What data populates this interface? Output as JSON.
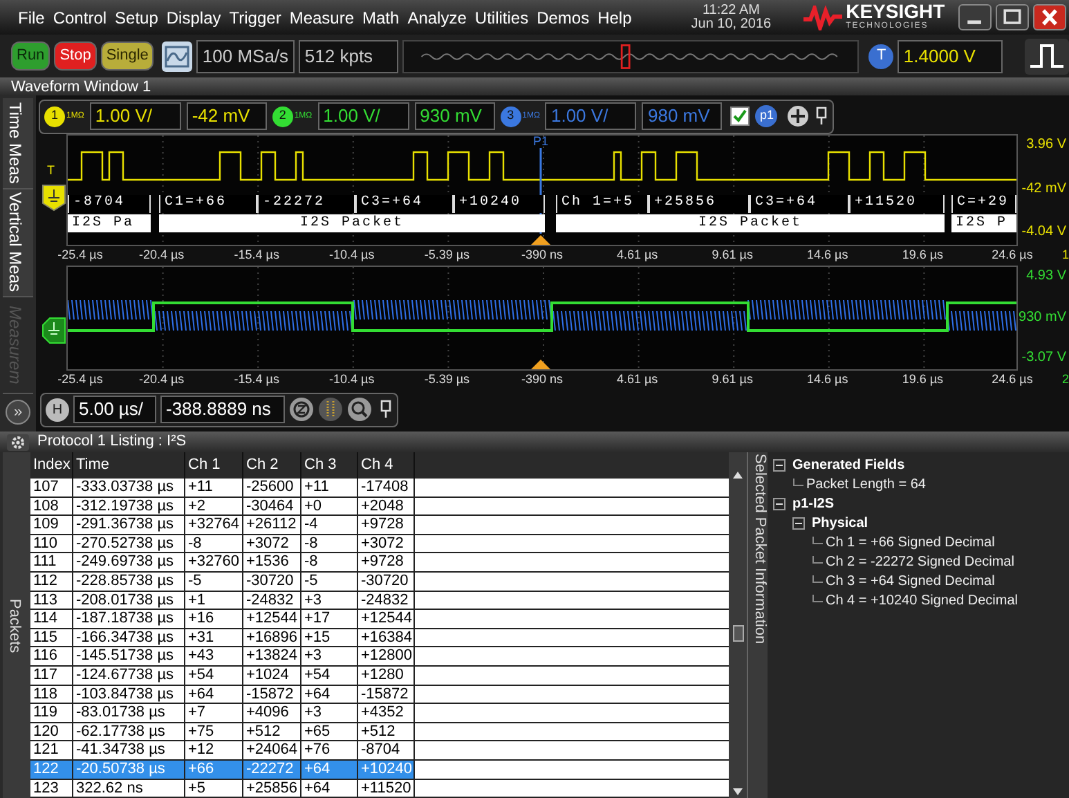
{
  "menu": [
    "File",
    "Control",
    "Setup",
    "Display",
    "Trigger",
    "Measure",
    "Math",
    "Analyze",
    "Utilities",
    "Demos",
    "Help"
  ],
  "clock": {
    "time": "11:22 AM",
    "date": "Jun 10, 2016"
  },
  "logo": {
    "name": "KEYSIGHT",
    "subtitle": "TECHNOLOGIES"
  },
  "acquisition_buttons": [
    {
      "label": "Run",
      "kind": "run"
    },
    {
      "label": "Stop",
      "kind": "stop"
    },
    {
      "label": "Single",
      "kind": "single"
    }
  ],
  "sample_rate": "100 MSa/s",
  "memory_depth": "512 kpts",
  "trigger": {
    "badge": "T",
    "level": "1.4000 V"
  },
  "waveform_window": {
    "title": "Waveform Window 1",
    "side_tabs": [
      {
        "label": "Time Meas",
        "disabled": false
      },
      {
        "label": "Vertical Meas",
        "disabled": false
      },
      {
        "label": "Measurem",
        "disabled": true
      }
    ],
    "channels": [
      {
        "badge": "1",
        "impedance": "1MΩ",
        "scale": "1.00 V/",
        "offset": "-42 mV",
        "color": "#e8e000"
      },
      {
        "badge": "2",
        "impedance": "1MΩ",
        "scale": "1.00 V/",
        "offset": "930 mV",
        "color": "#33dd33"
      },
      {
        "badge": "3",
        "impedance": "1MΩ",
        "scale": "1.00 V/",
        "offset": "980 mV",
        "color": "#3b78e0"
      }
    ],
    "expand_button": "»",
    "p1_checked": true,
    "p1_badge": "p1",
    "plots": [
      {
        "kind": "digital",
        "marker": "P1",
        "trigger_mark": "T",
        "scale_labels": [
          "3.96 V",
          "-42 mV",
          "-4.04 V"
        ],
        "edge_label": "1",
        "decode_values": [
          "-8704",
          "C1=+66",
          "-22272",
          "C3=+64",
          "+10240",
          "Ch 1=+5",
          "+25856",
          "C3=+64",
          "+11520",
          "C=+29"
        ],
        "decode_packets": [
          "I2S Pa",
          "I2S Packet",
          "I2S Packet",
          "I2S P"
        ],
        "x_ticks": [
          "-25.4 µs",
          "-20.4 µs",
          "-15.4 µs",
          "-10.4 µs",
          "-5.39 µs",
          "-390 ns",
          "4.61 µs",
          "9.61 µs",
          "14.6 µs",
          "19.6 µs",
          "24.6 µs"
        ]
      },
      {
        "kind": "analog",
        "scale_labels": [
          "4.93 V",
          "930 mV",
          "-3.07 V"
        ],
        "edge_label": "2",
        "x_ticks": [
          "-25.4 µs",
          "-20.4 µs",
          "-15.4 µs",
          "-10.4 µs",
          "-5.39 µs",
          "-390 ns",
          "4.61 µs",
          "9.61 µs",
          "14.6 µs",
          "19.6 µs",
          "24.6 µs"
        ]
      }
    ],
    "horizontal": {
      "badge": "H",
      "scale": "5.00 µs/",
      "delay": "-388.8889 ns"
    }
  },
  "protocol_listing": {
    "title": "Protocol 1 Listing : I²S",
    "side_tab": "Packets",
    "columns": [
      "Index",
      "Time",
      "Ch 1",
      "Ch 2",
      "Ch 3",
      "Ch 4"
    ],
    "rows": [
      {
        "cells": [
          "107",
          "-333.03738 µs",
          "+11",
          "-25600",
          "+11",
          "-17408"
        ],
        "selected": false
      },
      {
        "cells": [
          "108",
          "-312.19738 µs",
          "+2",
          "-30464",
          "+0",
          "+2048"
        ],
        "selected": false
      },
      {
        "cells": [
          "109",
          "-291.36738 µs",
          "+32764",
          "+26112",
          "-4",
          "+9728"
        ],
        "selected": false
      },
      {
        "cells": [
          "110",
          "-270.52738 µs",
          "-8",
          "+3072",
          "-8",
          "+3072"
        ],
        "selected": false
      },
      {
        "cells": [
          "111",
          "-249.69738 µs",
          "+32760",
          "+1536",
          "-8",
          "+9728"
        ],
        "selected": false
      },
      {
        "cells": [
          "112",
          "-228.85738 µs",
          "-5",
          "-30720",
          "-5",
          "-30720"
        ],
        "selected": false
      },
      {
        "cells": [
          "113",
          "-208.01738 µs",
          "+1",
          "-24832",
          "+3",
          "-24832"
        ],
        "selected": false
      },
      {
        "cells": [
          "114",
          "-187.18738 µs",
          "+16",
          "+12544",
          "+17",
          "+12544"
        ],
        "selected": false
      },
      {
        "cells": [
          "115",
          "-166.34738 µs",
          "+31",
          "+16896",
          "+15",
          "+16384"
        ],
        "selected": false
      },
      {
        "cells": [
          "116",
          "-145.51738 µs",
          "+43",
          "+13824",
          "+3",
          "+12800"
        ],
        "selected": false
      },
      {
        "cells": [
          "117",
          "-124.67738 µs",
          "+54",
          "+1024",
          "+54",
          "+1280"
        ],
        "selected": false
      },
      {
        "cells": [
          "118",
          "-103.84738 µs",
          "+64",
          "-15872",
          "+64",
          "-15872"
        ],
        "selected": false
      },
      {
        "cells": [
          "119",
          "-83.01738 µs",
          "+7",
          "+4096",
          "+3",
          "+4352"
        ],
        "selected": false
      },
      {
        "cells": [
          "120",
          "-62.17738 µs",
          "+75",
          "+512",
          "+65",
          "+512"
        ],
        "selected": false
      },
      {
        "cells": [
          "121",
          "-41.34738 µs",
          "+12",
          "+24064",
          "+76",
          "-8704"
        ],
        "selected": false
      },
      {
        "cells": [
          "122",
          "-20.50738 µs",
          "+66",
          "-22272",
          "+64",
          "+10240"
        ],
        "selected": true
      },
      {
        "cells": [
          "123",
          "322.62 ns",
          "+5",
          "+25856",
          "+64",
          "+11520"
        ],
        "selected": false
      }
    ],
    "detail_tab": "Selected Packet Information",
    "tree": [
      {
        "label": "Generated Fields",
        "expanded": true,
        "children": [
          {
            "label": "Packet Length = 64"
          }
        ]
      },
      {
        "label": "p1-I2S",
        "expanded": true,
        "children": [
          {
            "label": "Physical",
            "expanded": true,
            "children": [
              {
                "label": "Ch 1 = +66 Signed Decimal"
              },
              {
                "label": "Ch 2 = -22272 Signed Decimal"
              },
              {
                "label": "Ch 3 = +64 Signed Decimal"
              },
              {
                "label": "Ch 4 = +10240 Signed Decimal"
              }
            ]
          }
        ]
      }
    ]
  }
}
